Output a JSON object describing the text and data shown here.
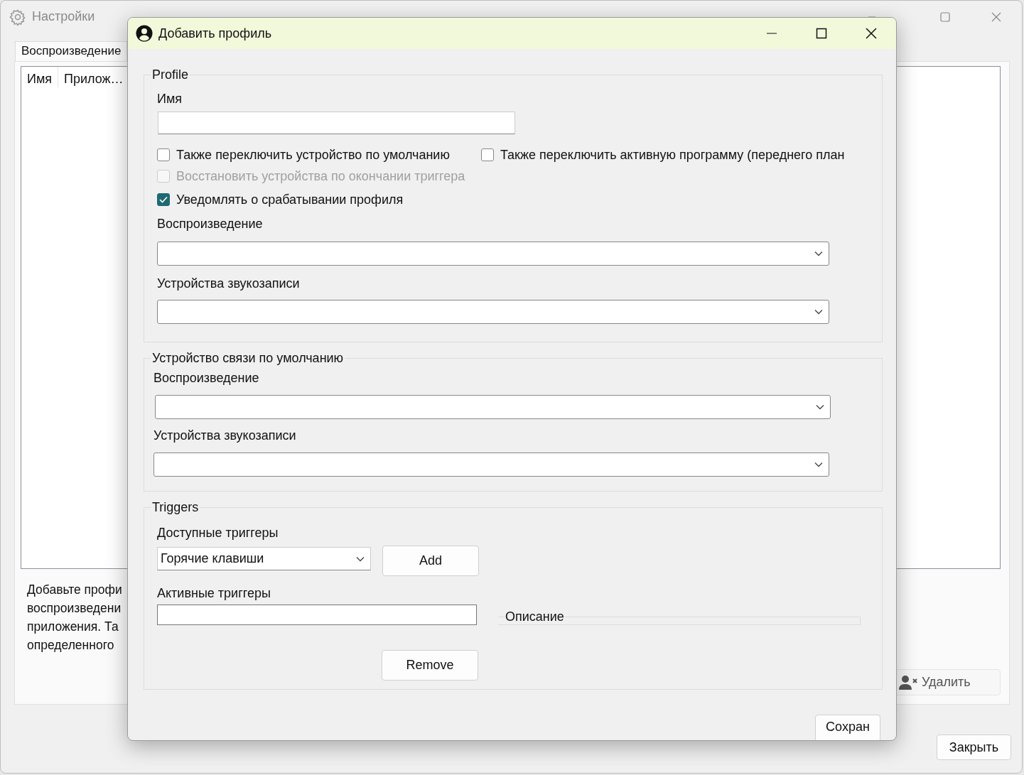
{
  "settings_window": {
    "title": "Настройки",
    "tabs": [
      {
        "label": "Воспроизведение",
        "selected": true
      }
    ],
    "columns": [
      "Имя",
      "Прилож…"
    ],
    "description_lines": [
      "Добавьте профи",
      "воспроизведени",
      "приложения. Та",
      "определенного"
    ],
    "delete_button": "Удалить",
    "close_button": "Закрыть"
  },
  "dialog": {
    "title": "Добавить профиль",
    "profile": {
      "legend": "Profile",
      "name_label": "Имя",
      "checkbox_rows": [
        [
          {
            "label": "Также переключить устройство по умолчанию",
            "checked": false,
            "disabled": false
          },
          {
            "label": "Также переключить активную программу (переднего план",
            "checked": false,
            "disabled": false
          }
        ],
        [
          {
            "label": "Восстановить устройства по окончании триггера",
            "checked": false,
            "disabled": true
          }
        ],
        [
          {
            "label": "Уведомлять о срабатывании профиля",
            "checked": true,
            "disabled": false
          }
        ]
      ],
      "playback_label": "Воспроизведение",
      "recording_label": "Устройства звукозаписи"
    },
    "default_comm": {
      "legend": "Устройство связи по умолчанию",
      "playback_label": "Воспроизведение",
      "recording_label": "Устройства звукозаписи"
    },
    "triggers": {
      "legend": "Triggers",
      "available_label": "Доступные триггеры",
      "available_value": "Горячие клавиши",
      "add_button": "Add",
      "active_label": "Активные триггеры",
      "description_legend": "Описание",
      "remove_button": "Remove"
    },
    "save_button": "Сохран"
  }
}
